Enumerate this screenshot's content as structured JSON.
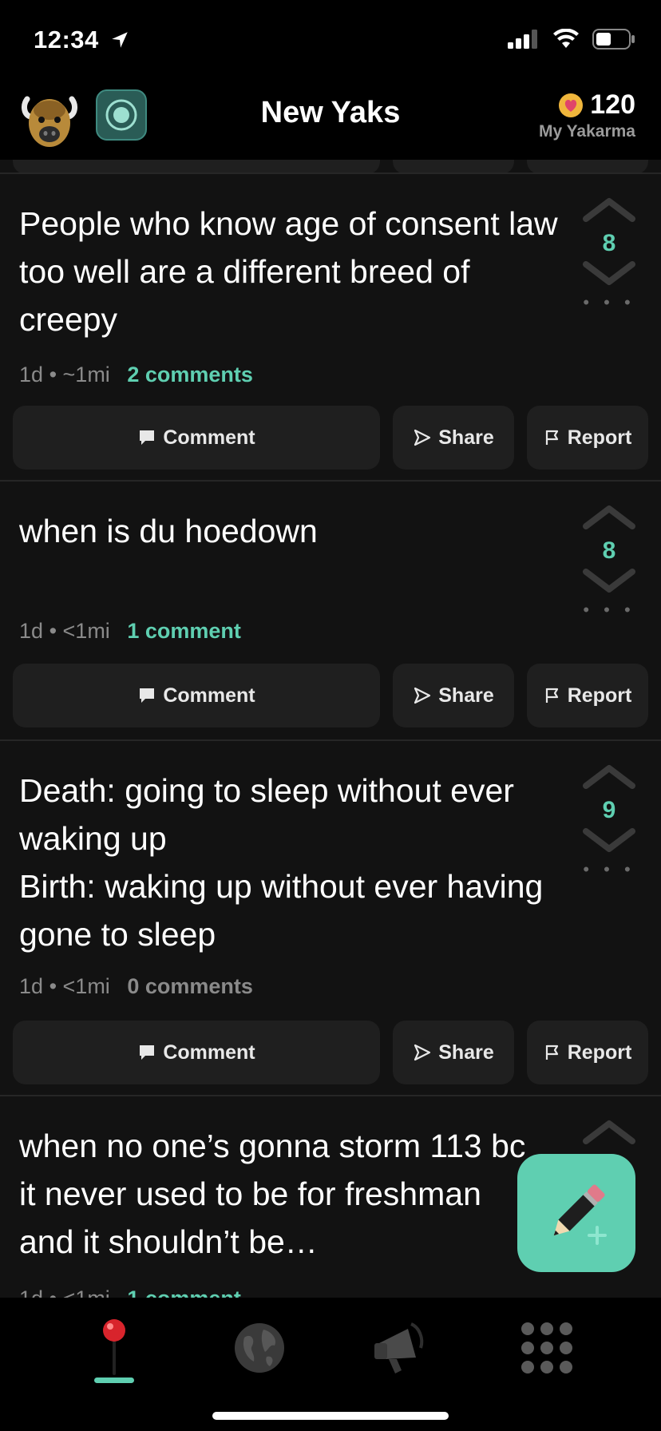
{
  "status_bar": {
    "time": "12:34"
  },
  "header": {
    "title": "New Yaks",
    "yakarma_count": "120",
    "yakarma_label": "My Yakarma"
  },
  "posts": [
    {
      "text": "People who know age of consent law too well are a different breed of creepy",
      "age": "1d",
      "distance": "~1mi",
      "comments": "2 comments",
      "score": "8"
    },
    {
      "text": "when is du hoedown",
      "age": "1d",
      "distance": "<1mi",
      "comments": "1 comment",
      "score": "8"
    },
    {
      "text": "Death: going to sleep without ever waking up\nBirth: waking up without ever having gone to sleep",
      "age": "1d",
      "distance": "<1mi",
      "comments": "0 comments",
      "score": "9"
    },
    {
      "text": "when no one’s gonna storm 113 bc it never used to be for freshman and it shouldn’t be…",
      "age": "1d",
      "distance": "<1mi",
      "comments": "1 comment",
      "score": ""
    }
  ],
  "actions": {
    "comment": "Comment",
    "share": "Share",
    "report": "Report"
  },
  "more_dots": "• • •",
  "meta_separator": "•",
  "colors": {
    "accent": "#5fcfb1",
    "background": "#121212",
    "button": "#1f1f1f"
  },
  "tabs": [
    "map-pin-icon",
    "globe-icon",
    "megaphone-icon",
    "grid-icon"
  ]
}
